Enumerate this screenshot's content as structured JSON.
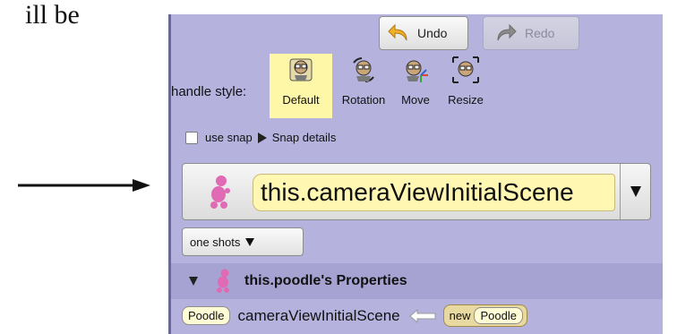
{
  "document": {
    "text_fragment": "ill be"
  },
  "toolbar": {
    "undo_label": "Undo",
    "redo_label": "Redo"
  },
  "handle_style": {
    "label": "handle style:",
    "options": [
      {
        "label": "Default",
        "selected": true
      },
      {
        "label": "Rotation",
        "selected": false
      },
      {
        "label": "Move",
        "selected": false
      },
      {
        "label": "Resize",
        "selected": false
      }
    ]
  },
  "snap": {
    "checkbox_label": "use snap",
    "checked": false,
    "details_label": "Snap details"
  },
  "expression": {
    "value": "this.cameraViewInitialScene",
    "icon": "poodle-icon"
  },
  "one_shots": {
    "label": "one shots"
  },
  "properties": {
    "title": "this.poodle's Properties",
    "row": {
      "type": "Poodle",
      "name": "cameraViewInitialScene",
      "new_keyword": "new",
      "new_type": "Poodle"
    }
  },
  "colors": {
    "panel": "#b5b3de",
    "header": "#a6a3d2",
    "expression_fill": "#fff7b2",
    "selected_option": "#fff7a8"
  }
}
